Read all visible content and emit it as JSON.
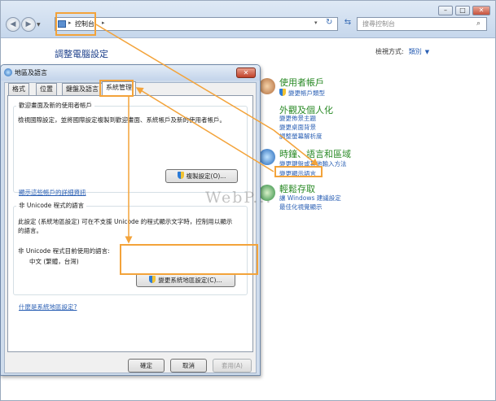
{
  "window": {
    "controls": [
      "–",
      "□",
      "✕"
    ],
    "breadcrumb": "控制台",
    "search_placeholder": "搜尋控制台",
    "page_title": "調整電腦設定",
    "view_by_label": "檢視方式:",
    "view_by_value": "類別"
  },
  "categories": [
    {
      "title": "使用者帳戶",
      "links": [
        "變更帳戶類型"
      ]
    },
    {
      "title": "外觀及個人化",
      "links": [
        "變更佈景主題",
        "變更桌面背景",
        "調整螢幕解析度"
      ]
    },
    {
      "title": "時鐘、語言和區域",
      "links": [
        "變更鍵盤或其他輸入方法",
        "變更顯示語言"
      ]
    },
    {
      "title": "輕鬆存取",
      "links": [
        "讓 Windows 建議設定",
        "最佳化視覺顯示"
      ]
    }
  ],
  "dialog": {
    "title": "地區及語言",
    "tabs": [
      "格式",
      "位置",
      "鍵盤及語言",
      "系統管理"
    ],
    "welcome_group": {
      "label": "歡迎畫面及新的使用者帳戶",
      "text": "檢視國際設定，並將國際設定複製到歡迎畫面、系統帳戶及新的使用者帳戶。",
      "copy_button": "複製設定(O)...",
      "link": "顯示這些帳戶的詳細資訊"
    },
    "unicode_group": {
      "label": "非 Unicode 程式的語言",
      "text": "此設定 (系統地區設定) 可在不支援 Unicode 的程式顯示文字時，控制用以顯示的語言。",
      "current_label": "非 Unicode 程式目前使用的語言:",
      "current_value": "中文 (繁體，台灣)",
      "change_button": "變更系統地區設定(C)..."
    },
    "help_link": "什麼是系統地區設定?",
    "buttons": {
      "ok": "確定",
      "cancel": "取消",
      "apply": "套用(A)"
    }
  },
  "watermark": "WebP..."
}
